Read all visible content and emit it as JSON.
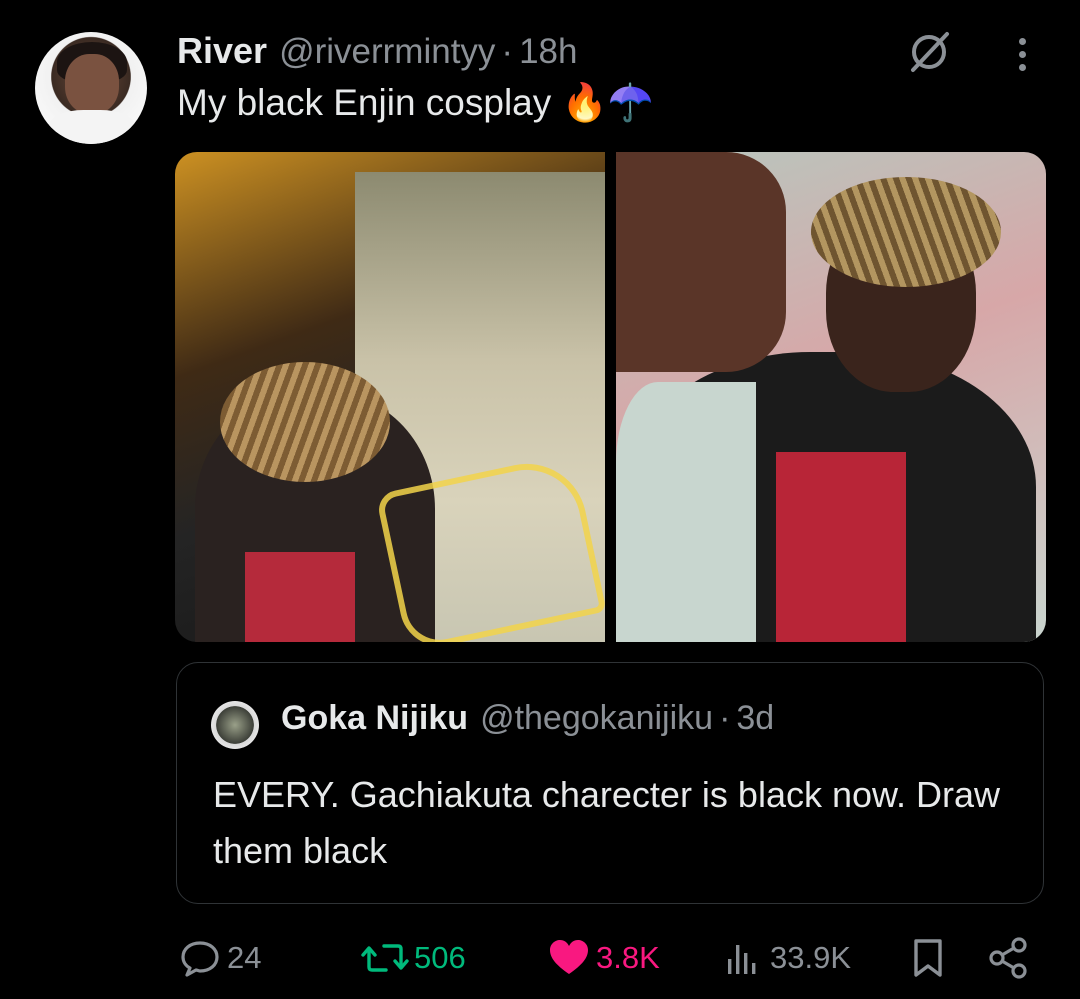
{
  "tweet": {
    "author_name": "River",
    "author_handle": "@riverrmintyy",
    "separator": "·",
    "time": "18h",
    "text": "My black Enjin cosplay 🔥☂️"
  },
  "media": [
    {
      "description": "cosplay photo beside Enjin artwork"
    },
    {
      "description": "cosplay photo"
    }
  ],
  "quoted_tweet": {
    "author_name": "Goka Nijiku",
    "author_handle": "@thegokanijiku",
    "separator": "·",
    "time": "3d",
    "text": "EVERY. Gachiakuta charecter is black now. Draw them black"
  },
  "actions": {
    "replies": "24",
    "reposts": "506",
    "likes": "3.8K",
    "views": "33.9K"
  },
  "icons": {
    "grok": "grok-icon",
    "more": "more-icon",
    "reply": "reply-icon",
    "repost": "repost-icon",
    "like": "heart-icon",
    "views": "views-icon",
    "bookmark": "bookmark-icon",
    "share": "share-icon"
  },
  "colors": {
    "background": "#000000",
    "text": "#e7e9ea",
    "muted": "#8b9096",
    "repost": "#00ba7c",
    "like": "#f91880",
    "border": "#2f3336"
  }
}
